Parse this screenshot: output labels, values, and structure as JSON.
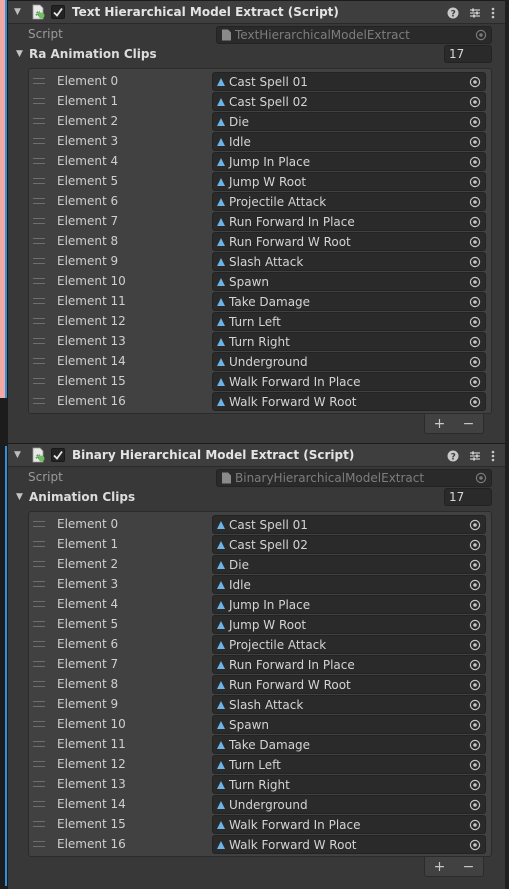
{
  "components": [
    {
      "title": "Text Hierarchical Model Extract (Script)",
      "script_label": "Script",
      "script_value": "TextHierarchicalModelExtract",
      "array_label": "Ra Animation Clips",
      "array_size": "17",
      "elements": [
        {
          "label": "Element 0",
          "value": "Cast Spell 01"
        },
        {
          "label": "Element 1",
          "value": "Cast Spell 02"
        },
        {
          "label": "Element 2",
          "value": "Die"
        },
        {
          "label": "Element 3",
          "value": "Idle"
        },
        {
          "label": "Element 4",
          "value": "Jump In Place"
        },
        {
          "label": "Element 5",
          "value": "Jump W Root"
        },
        {
          "label": "Element 6",
          "value": "Projectile Attack"
        },
        {
          "label": "Element 7",
          "value": "Run Forward In Place"
        },
        {
          "label": "Element 8",
          "value": "Run Forward W Root"
        },
        {
          "label": "Element 9",
          "value": "Slash Attack"
        },
        {
          "label": "Element 10",
          "value": "Spawn"
        },
        {
          "label": "Element 11",
          "value": "Take Damage"
        },
        {
          "label": "Element 12",
          "value": "Turn Left"
        },
        {
          "label": "Element 13",
          "value": "Turn Right"
        },
        {
          "label": "Element 14",
          "value": "Underground"
        },
        {
          "label": "Element 15",
          "value": "Walk Forward In Place"
        },
        {
          "label": "Element 16",
          "value": "Walk Forward W Root"
        }
      ],
      "add_label": "+",
      "remove_label": "−"
    },
    {
      "title": "Binary Hierarchical Model Extract (Script)",
      "script_label": "Script",
      "script_value": "BinaryHierarchicalModelExtract",
      "array_label": "Animation Clips",
      "array_size": "17",
      "elements": [
        {
          "label": "Element 0",
          "value": "Cast Spell 01"
        },
        {
          "label": "Element 1",
          "value": "Cast Spell 02"
        },
        {
          "label": "Element 2",
          "value": "Die"
        },
        {
          "label": "Element 3",
          "value": "Idle"
        },
        {
          "label": "Element 4",
          "value": "Jump In Place"
        },
        {
          "label": "Element 5",
          "value": "Jump W Root"
        },
        {
          "label": "Element 6",
          "value": "Projectile Attack"
        },
        {
          "label": "Element 7",
          "value": "Run Forward In Place"
        },
        {
          "label": "Element 8",
          "value": "Run Forward W Root"
        },
        {
          "label": "Element 9",
          "value": "Slash Attack"
        },
        {
          "label": "Element 10",
          "value": "Spawn"
        },
        {
          "label": "Element 11",
          "value": "Take Damage"
        },
        {
          "label": "Element 12",
          "value": "Turn Left"
        },
        {
          "label": "Element 13",
          "value": "Turn Right"
        },
        {
          "label": "Element 14",
          "value": "Underground"
        },
        {
          "label": "Element 15",
          "value": "Walk Forward In Place"
        },
        {
          "label": "Element 16",
          "value": "Walk Forward W Root"
        }
      ],
      "add_label": "+",
      "remove_label": "−"
    }
  ],
  "icons": {
    "foldout": "foldout-arrow-icon",
    "script": "csharp-script-icon",
    "checkbox": "checkmark-icon",
    "help": "help-icon",
    "presets": "presets-sliders-icon",
    "menu": "kebab-menu-icon",
    "animation_clip": "animation-clip-icon",
    "object_picker": "object-picker-target-icon",
    "drag": "drag-handle-icon"
  },
  "colors": {
    "background": "#383838",
    "field": "#2a2a2a",
    "list_box": "#414141",
    "selection_bar": "#2f8fd8",
    "clip_icon": "#6ab4e8"
  }
}
